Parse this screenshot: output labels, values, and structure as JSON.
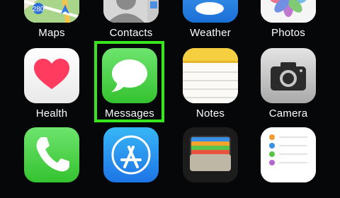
{
  "home_screen": {
    "apps": [
      {
        "label": "Maps",
        "icon": "maps-icon"
      },
      {
        "label": "Contacts",
        "icon": "contacts-icon"
      },
      {
        "label": "Weather",
        "icon": "weather-icon"
      },
      {
        "label": "Photos",
        "icon": "photos-icon"
      },
      {
        "label": "Health",
        "icon": "health-icon"
      },
      {
        "label": "Messages",
        "icon": "messages-icon"
      },
      {
        "label": "Notes",
        "icon": "notes-icon"
      },
      {
        "label": "Camera",
        "icon": "camera-icon"
      },
      {
        "label": "Phone",
        "icon": "phone-icon"
      },
      {
        "label": "App Store",
        "icon": "app-store-icon"
      },
      {
        "label": "Wallet",
        "icon": "wallet-icon"
      },
      {
        "label": "Reminders",
        "icon": "reminders-icon"
      }
    ],
    "highlighted_app": "Messages",
    "colors": {
      "highlight": "#39e51d",
      "messages_green": "#4cd964",
      "background": "#060708"
    }
  }
}
